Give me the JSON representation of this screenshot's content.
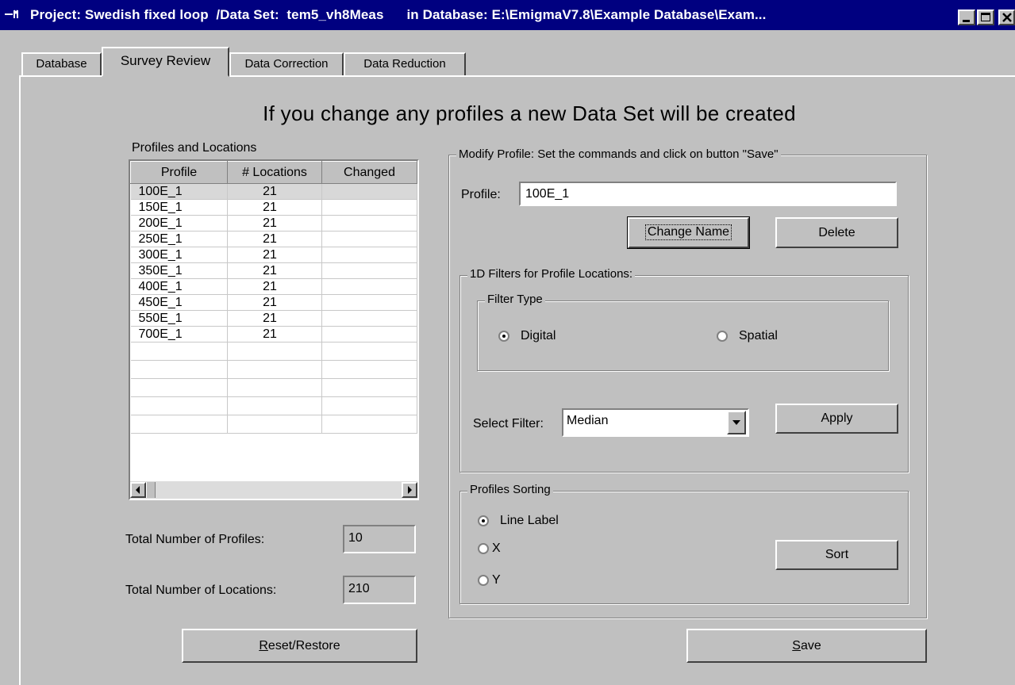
{
  "window": {
    "title": "Project: Swedish fixed loop  /Data Set:  tem5_vh8Meas      in Database: E:\\EmigmaV7.8\\Example Database\\Exam..."
  },
  "tabs": [
    {
      "label": "Database"
    },
    {
      "label": "Survey Review"
    },
    {
      "label": "Data Correction"
    },
    {
      "label": "Data Reduction"
    }
  ],
  "headline": "If you change any profiles a new Data Set will be created",
  "profiles_table": {
    "caption": "Profiles and Locations",
    "columns": [
      "Profile",
      "# Locations",
      "Changed"
    ],
    "rows": [
      {
        "profile": "100E_1",
        "locations": "21",
        "changed": ""
      },
      {
        "profile": "150E_1",
        "locations": "21",
        "changed": ""
      },
      {
        "profile": "200E_1",
        "locations": "21",
        "changed": ""
      },
      {
        "profile": "250E_1",
        "locations": "21",
        "changed": ""
      },
      {
        "profile": "300E_1",
        "locations": "21",
        "changed": ""
      },
      {
        "profile": "350E_1",
        "locations": "21",
        "changed": ""
      },
      {
        "profile": "400E_1",
        "locations": "21",
        "changed": ""
      },
      {
        "profile": "450E_1",
        "locations": "21",
        "changed": ""
      },
      {
        "profile": "550E_1",
        "locations": "21",
        "changed": ""
      },
      {
        "profile": "700E_1",
        "locations": "21",
        "changed": ""
      }
    ],
    "selected_row": 0
  },
  "totals": {
    "profiles_label": "Total Number of Profiles:",
    "profiles_value": "10",
    "locations_label": "Total Number of Locations:",
    "locations_value": "210"
  },
  "modify": {
    "legend": "Modify Profile: Set the commands and click on button \"Save\"",
    "profile_label": "Profile:",
    "profile_value": "100E_1",
    "change_name_label": "Change Name",
    "delete_label": "Delete"
  },
  "filters": {
    "legend": "1D Filters for Profile Locations:",
    "filter_type_legend": "Filter Type",
    "digital_label": "Digital",
    "spatial_label": "Spatial",
    "selected_type": "Digital",
    "select_filter_label": "Select Filter:",
    "select_filter_value": "Median",
    "apply_label": "Apply"
  },
  "sorting": {
    "legend": "Profiles Sorting",
    "options": [
      "Line Label",
      "X",
      "Y"
    ],
    "selected": "Line Label",
    "sort_label": "Sort"
  },
  "footer": {
    "reset_prefix": "R",
    "reset_rest": "eset/Restore",
    "save_prefix": "S",
    "save_rest": "ave"
  },
  "icons": [
    "app-icon",
    "minimize-icon",
    "maximize-icon",
    "close-icon",
    "dropdown-arrow-icon",
    "scroll-left-icon",
    "scroll-right-icon"
  ]
}
